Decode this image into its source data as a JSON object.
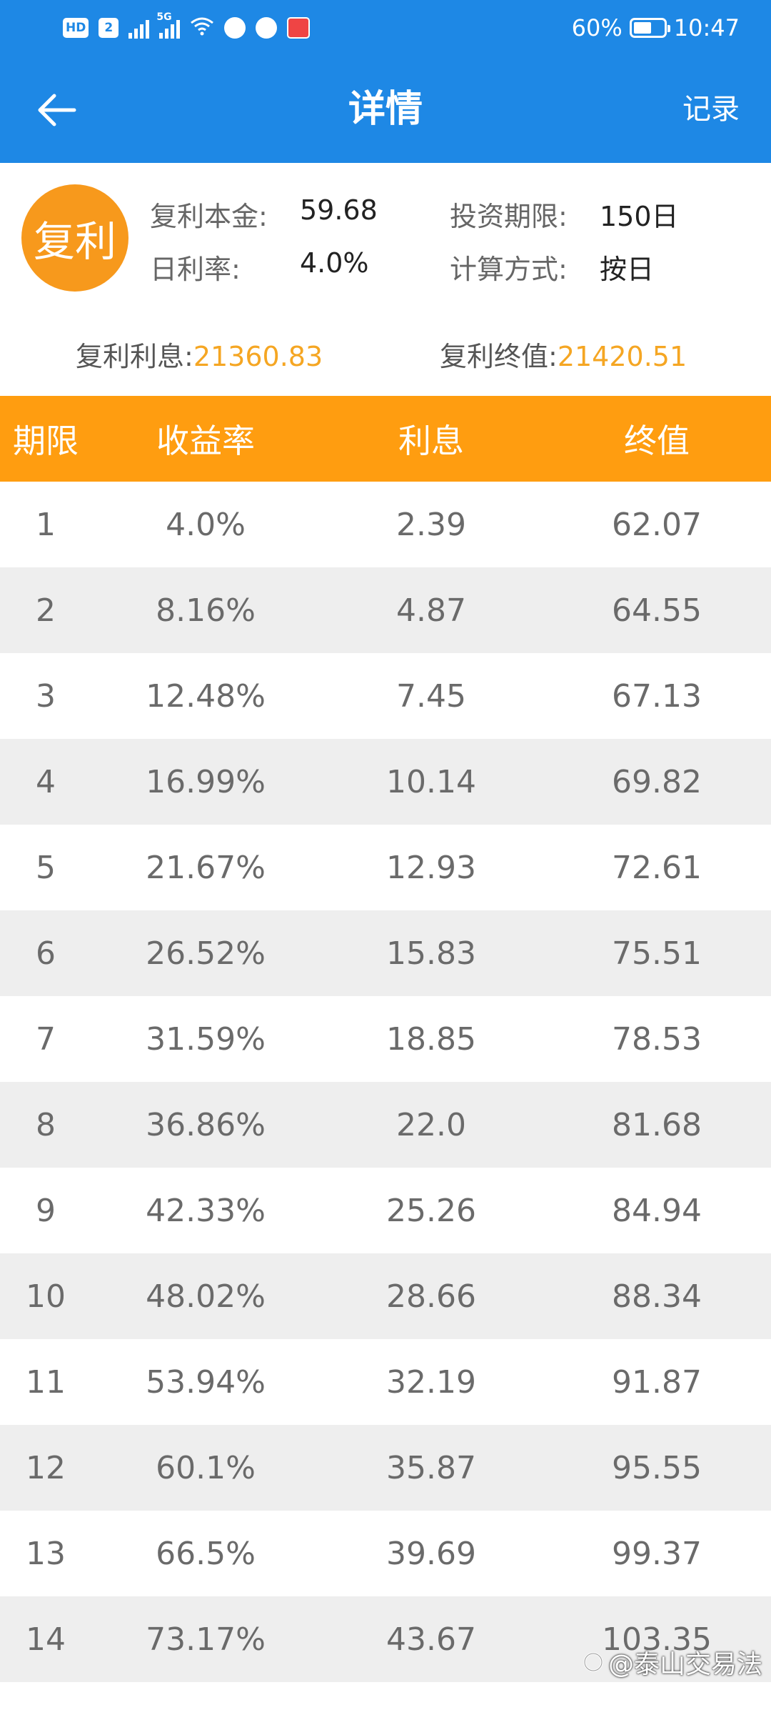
{
  "status_bar": {
    "hd_label": "HD",
    "sim_label": "2",
    "network_tag": "5G",
    "battery": "60%",
    "battery_level": 0.6,
    "time": "10:47"
  },
  "nav": {
    "title": "详情",
    "action": "记录"
  },
  "summary": {
    "badge": "复利",
    "principal_label": "复利本金:",
    "principal_value": "59.68",
    "term_label": "投资期限:",
    "term_value": "150日",
    "rate_label": "日利率:",
    "rate_value": "4.0%",
    "method_label": "计算方式:",
    "method_value": "按日",
    "interest_label": "复利利息:",
    "interest_value": "21360.83",
    "final_label": "复利终值:",
    "final_value": "21420.51"
  },
  "table": {
    "headers": [
      "期限",
      "收益率",
      "利息",
      "终值"
    ],
    "rows": [
      [
        "1",
        "4.0%",
        "2.39",
        "62.07"
      ],
      [
        "2",
        "8.16%",
        "4.87",
        "64.55"
      ],
      [
        "3",
        "12.48%",
        "7.45",
        "67.13"
      ],
      [
        "4",
        "16.99%",
        "10.14",
        "69.82"
      ],
      [
        "5",
        "21.67%",
        "12.93",
        "72.61"
      ],
      [
        "6",
        "26.52%",
        "15.83",
        "75.51"
      ],
      [
        "7",
        "31.59%",
        "18.85",
        "78.53"
      ],
      [
        "8",
        "36.86%",
        "22.0",
        "81.68"
      ],
      [
        "9",
        "42.33%",
        "25.26",
        "84.94"
      ],
      [
        "10",
        "48.02%",
        "28.66",
        "88.34"
      ],
      [
        "11",
        "53.94%",
        "32.19",
        "91.87"
      ],
      [
        "12",
        "60.1%",
        "35.87",
        "95.55"
      ],
      [
        "13",
        "66.5%",
        "39.69",
        "99.37"
      ],
      [
        "14",
        "73.17%",
        "43.67",
        "103.35"
      ]
    ]
  },
  "watermark": "@泰山交易法",
  "colors": {
    "primary": "#1e88e5",
    "accent": "#ff9d10",
    "badge": "#f7991c",
    "highlight": "#f5a623"
  }
}
